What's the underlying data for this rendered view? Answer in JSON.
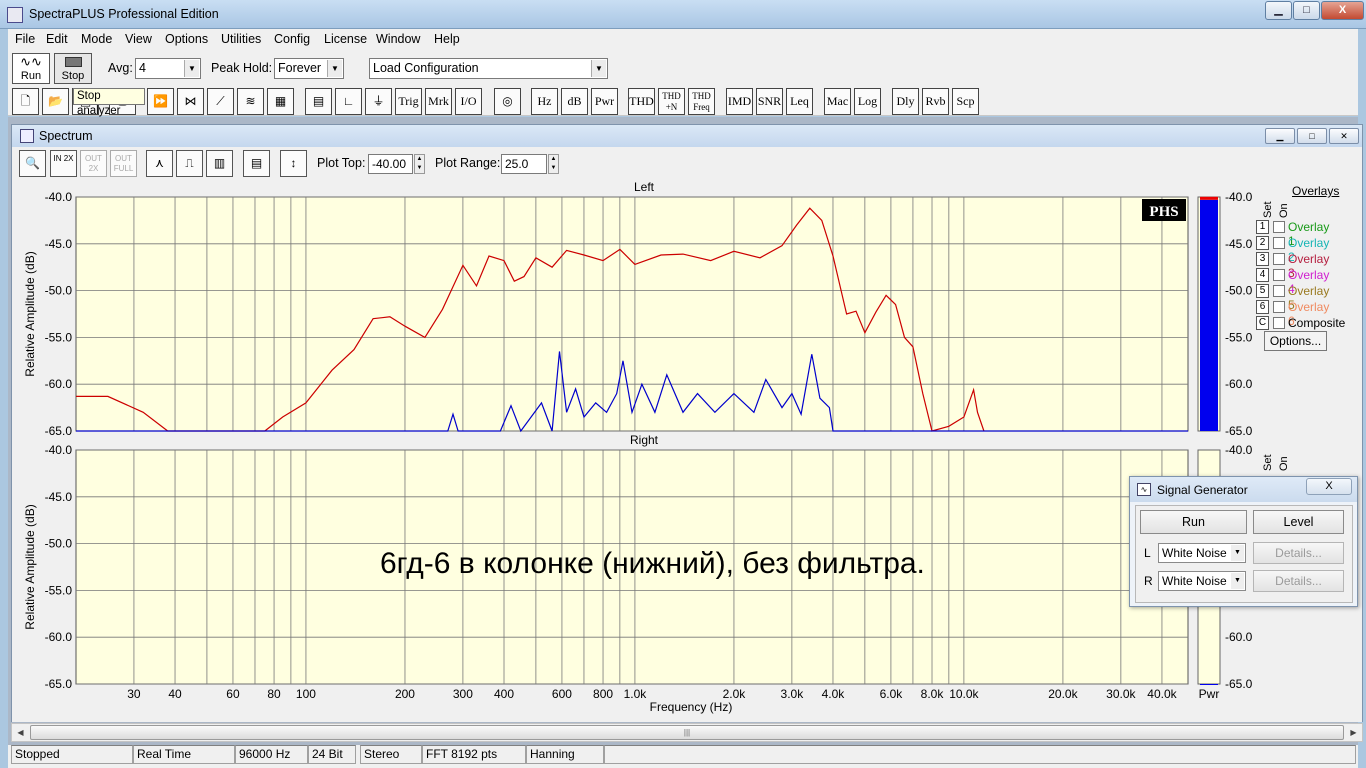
{
  "app": {
    "title": "SpectraPLUS Professional Edition",
    "window_buttons": {
      "minimize": "▁",
      "maximize": "□",
      "close": "X"
    }
  },
  "menu": [
    "File",
    "Edit",
    "Mode",
    "View",
    "Options",
    "Utilities",
    "Config",
    "License",
    "Window",
    "Help"
  ],
  "toolbar1": {
    "run_label": "Run",
    "stop_label": "Stop",
    "avg_label": "Avg:",
    "avg_value": "4",
    "peak_hold_label": "Peak Hold:",
    "peak_hold_value": "Forever",
    "config_value": "Load Configuration"
  },
  "tooltip": "Stop analyzer",
  "toolbar2": {
    "text_buttons": [
      "Trig",
      "Mrk",
      "I/O",
      "Hz",
      "dB",
      "Pwr",
      "THD",
      "THD +N",
      "THD Freq",
      "IMD",
      "SNR",
      "Leq",
      "Mac",
      "Log",
      "Dly",
      "Rvb",
      "Scp"
    ],
    "icons": [
      "new-file-icon",
      "open-file-icon",
      "save-icon",
      "print-icon",
      "fast-forward-icon",
      "scope-icon",
      "ramp-icon",
      "waterfall-icon",
      "3d-surface-icon",
      "table-icon",
      "axis-icon",
      "phase-icon",
      "sine-wave-icon"
    ]
  },
  "spectrum": {
    "title": "Spectrum",
    "plot_top_label": "Plot Top:",
    "plot_top_value": "-40.00",
    "plot_range_label": "Plot Range:",
    "plot_range_value": "25.0",
    "toolbar_icons": [
      "zoom-icon",
      "zoom-in-2x-icon",
      "zoom-out-2x-icon",
      "zoom-out-full-icon",
      "line-plot-icon",
      "step-plot-icon",
      "bar-plot-icon",
      "spectrum-properties-icon",
      "autoscale-icon"
    ],
    "zoom_labels": {
      "in": "IN 2X",
      "out": "OUT 2X",
      "full": "OUT FULL"
    },
    "watermark": "PHS",
    "caption": "6гд-6 в колонке (нижний), без фильтра."
  },
  "overlays": {
    "title": "Overlays",
    "col_set": "Set",
    "col_on": "On",
    "items": [
      {
        "num": "1",
        "label": "Overlay 1",
        "color": "#199a19"
      },
      {
        "num": "2",
        "label": "Overlay 2",
        "color": "#17b5b5"
      },
      {
        "num": "3",
        "label": "Overlay 3",
        "color": "#b52040"
      },
      {
        "num": "4",
        "label": "Overlay 4",
        "color": "#d020d0"
      },
      {
        "num": "5",
        "label": "Overlay 5",
        "color": "#9a7a20"
      },
      {
        "num": "6",
        "label": "Overlay 6",
        "color": "#f08a60"
      },
      {
        "num": "C",
        "label": "Composite",
        "color": "#000000"
      }
    ],
    "options_label": "Options..."
  },
  "signal_generator": {
    "title": "Signal Generator",
    "close": "X",
    "run_label": "Run",
    "level_label": "Level",
    "left_label": "L",
    "right_label": "R",
    "left_signal": "White Noise",
    "right_signal": "White Noise",
    "details_label": "Details..."
  },
  "status": [
    "Stopped",
    "Real Time",
    "96000 Hz",
    "24 Bit",
    "Stereo",
    "FFT 8192 pts",
    "Hanning"
  ],
  "chart_data": [
    {
      "type": "line",
      "title": "Left",
      "xlabel": "Frequency (Hz)",
      "ylabel": "Relative Amplitude (dB)",
      "x_scale": "log",
      "xlim": [
        20,
        48000
      ],
      "ylim": [
        -65,
        -40
      ],
      "yticks": [
        "-40.0",
        "-45.0",
        "-50.0",
        "-55.0",
        "-60.0",
        "-65.0"
      ],
      "xticks": [
        "30",
        "40",
        "60",
        "80",
        "100",
        "200",
        "300",
        "400",
        "600",
        "800",
        "1.0k",
        "2.0k",
        "3.0k",
        "4.0k",
        "6.0k",
        "8.0k",
        "10.0k",
        "20.0k",
        "30.0k",
        "40.0k"
      ],
      "grid": true,
      "series": [
        {
          "color": "#cc0000",
          "points": [
            [
              20,
              -61.3
            ],
            [
              25,
              -61.3
            ],
            [
              32,
              -63
            ],
            [
              38,
              -65
            ],
            [
              75,
              -65
            ],
            [
              85,
              -63.5
            ],
            [
              100,
              -62
            ],
            [
              120,
              -58.5
            ],
            [
              140,
              -56.3
            ],
            [
              160,
              -53
            ],
            [
              180,
              -52.8
            ],
            [
              200,
              -53.8
            ],
            [
              230,
              -55
            ],
            [
              260,
              -52
            ],
            [
              300,
              -47.3
            ],
            [
              330,
              -49.5
            ],
            [
              360,
              -46.3
            ],
            [
              400,
              -46.8
            ],
            [
              430,
              -49
            ],
            [
              460,
              -48.5
            ],
            [
              500,
              -46.5
            ],
            [
              560,
              -47.5
            ],
            [
              620,
              -45.7
            ],
            [
              700,
              -46.2
            ],
            [
              800,
              -46.8
            ],
            [
              900,
              -45.6
            ],
            [
              1000,
              -47.2
            ],
            [
              1200,
              -46.2
            ],
            [
              1400,
              -46.1
            ],
            [
              1700,
              -46.8
            ],
            [
              2000,
              -45.8
            ],
            [
              2400,
              -46.5
            ],
            [
              2800,
              -45.2
            ],
            [
              3100,
              -43
            ],
            [
              3400,
              -41.2
            ],
            [
              3700,
              -42.5
            ],
            [
              4000,
              -46.3
            ],
            [
              4400,
              -52.5
            ],
            [
              4700,
              -52.2
            ],
            [
              5000,
              -54.5
            ],
            [
              5400,
              -52.3
            ],
            [
              5800,
              -50.5
            ],
            [
              6200,
              -51.5
            ],
            [
              6600,
              -55
            ],
            [
              7000,
              -56
            ],
            [
              7500,
              -61
            ],
            [
              8000,
              -65
            ],
            [
              9000,
              -64.5
            ],
            [
              10000,
              -63.5
            ],
            [
              10700,
              -60.6
            ],
            [
              11000,
              -63
            ],
            [
              11500,
              -65
            ]
          ]
        },
        {
          "color": "#0000cc",
          "points": [
            [
              20,
              -65
            ],
            [
              270,
              -65
            ],
            [
              280,
              -63.2
            ],
            [
              290,
              -65
            ],
            [
              390,
              -65
            ],
            [
              420,
              -62.3
            ],
            [
              450,
              -65
            ],
            [
              520,
              -62
            ],
            [
              560,
              -65
            ],
            [
              590,
              -56.5
            ],
            [
              620,
              -63
            ],
            [
              660,
              -60.5
            ],
            [
              700,
              -63.5
            ],
            [
              760,
              -62
            ],
            [
              820,
              -63
            ],
            [
              880,
              -61
            ],
            [
              920,
              -57.5
            ],
            [
              980,
              -63
            ],
            [
              1050,
              -60
            ],
            [
              1150,
              -63
            ],
            [
              1250,
              -59
            ],
            [
              1400,
              -63
            ],
            [
              1550,
              -61
            ],
            [
              1750,
              -63
            ],
            [
              2000,
              -61
            ],
            [
              2300,
              -63
            ],
            [
              2500,
              -59.5
            ],
            [
              2800,
              -62.5
            ],
            [
              3000,
              -61
            ],
            [
              3200,
              -63.2
            ],
            [
              3450,
              -56.8
            ],
            [
              3650,
              -61.5
            ],
            [
              3900,
              -62.5
            ],
            [
              4000,
              -65
            ],
            [
              12000,
              -65
            ],
            [
              48000,
              -65
            ]
          ]
        }
      ]
    },
    {
      "type": "line",
      "title": "Right",
      "xlabel": "Frequency (Hz)",
      "ylabel": "Relative Amplitude (dB)",
      "x_scale": "log",
      "xlim": [
        20,
        48000
      ],
      "ylim": [
        -65,
        -40
      ],
      "yticks": [
        "-40.0",
        "-45.0",
        "-50.0",
        "-55.0",
        "-60.0",
        "-65.0"
      ],
      "grid": true,
      "series": []
    },
    {
      "type": "bar",
      "title": "Pwr",
      "ylim": [
        -65,
        -40
      ],
      "yticks": [
        "-40.0",
        "-45.0",
        "-50.0",
        "-55.0",
        "-60.0",
        "-65.0"
      ],
      "series": [
        {
          "color": "#0000ee",
          "values": [
            -40.3
          ],
          "peak_color": "#ee0000"
        },
        {
          "color": "#0000ee",
          "values": [
            -65
          ]
        }
      ]
    }
  ]
}
